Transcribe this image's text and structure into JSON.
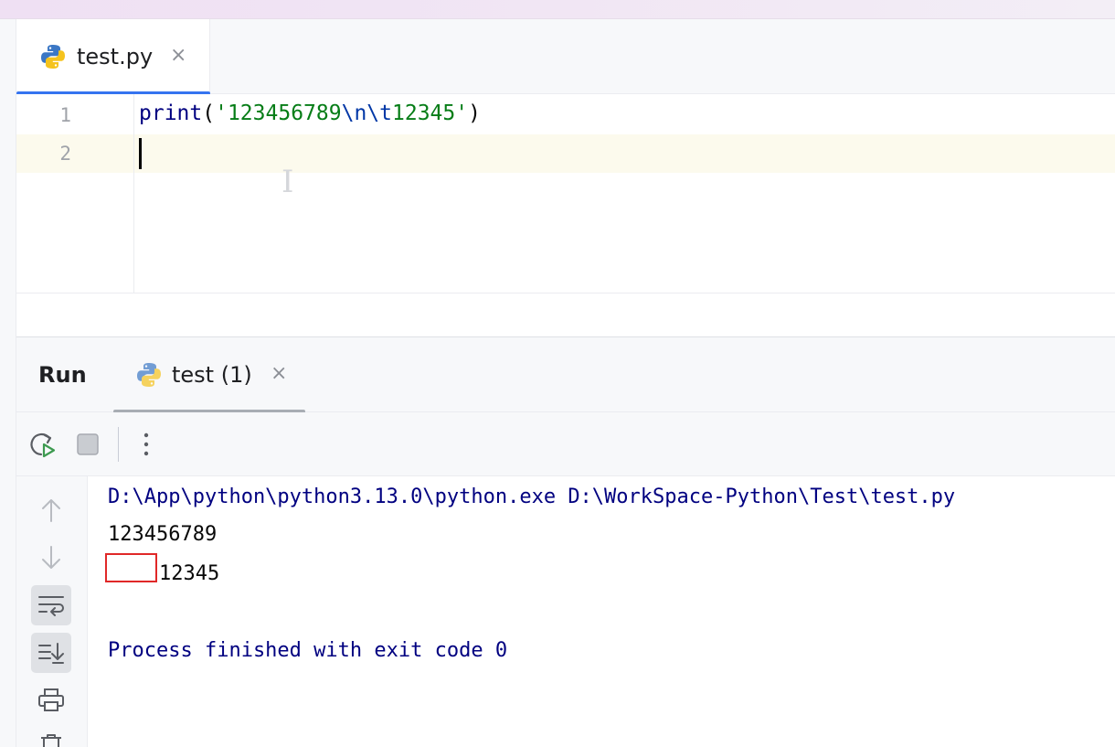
{
  "editor": {
    "tab_label": "test.py",
    "close_glyph": "×",
    "line_numbers": [
      "1",
      "2"
    ],
    "code": {
      "fn": "print",
      "open": "(",
      "str_a": "'123456789",
      "esc_n": "\\n",
      "esc_t": "\\t",
      "str_b": "12345'",
      "close": ")"
    }
  },
  "run": {
    "title": "Run",
    "tab_label": "test (1)",
    "close_glyph": "×"
  },
  "toolbar": {
    "icons": [
      "rerun-icon",
      "stop-icon",
      "more-options-icon"
    ]
  },
  "side_tools": {
    "icons": [
      "arrow-up-icon",
      "arrow-down-icon",
      "soft-wrap-icon",
      "scroll-to-end-icon",
      "print-icon",
      "trash-icon"
    ]
  },
  "console": {
    "command": "D:\\App\\python\\python3.13.0\\python.exe D:\\WorkSpace-Python\\Test\\test.py",
    "out_line1": "123456789",
    "out_line2": "12345",
    "process": "Process finished with exit code 0"
  },
  "colors": {
    "accent": "#3574f0",
    "string": "#067d17",
    "escape": "#0037a6",
    "keyword": "#000080",
    "highlight_box": "#e02828"
  }
}
